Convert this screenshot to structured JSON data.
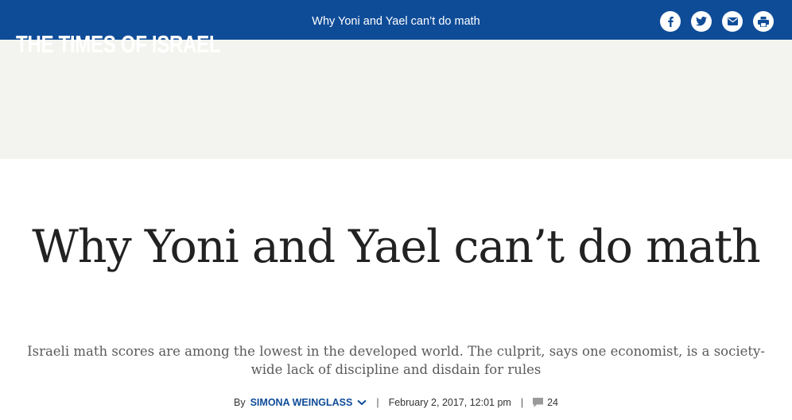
{
  "header": {
    "logo_text": "THE TIMES OF ISRAEL",
    "article_title": "Why Yoni and Yael can’t do math",
    "share_icons": [
      "facebook-icon",
      "twitter-icon",
      "email-icon",
      "print-icon"
    ]
  },
  "article": {
    "headline": "Why Yoni and Yael can’t do math",
    "subheadline": "Israeli math scores are among the lowest in the developed world. The culprit, says one economist, is a society-wide lack of discipline and disdain for rules",
    "byline_prefix": "By",
    "author": "SIMONA WEINGLASS",
    "separator": "|",
    "date": "February 2, 2017, 12:01 pm",
    "comment_count": "24"
  },
  "colors": {
    "brand_blue": "#0f4c98",
    "ad_background": "#f3f3ef",
    "headline_text": "#222222"
  }
}
